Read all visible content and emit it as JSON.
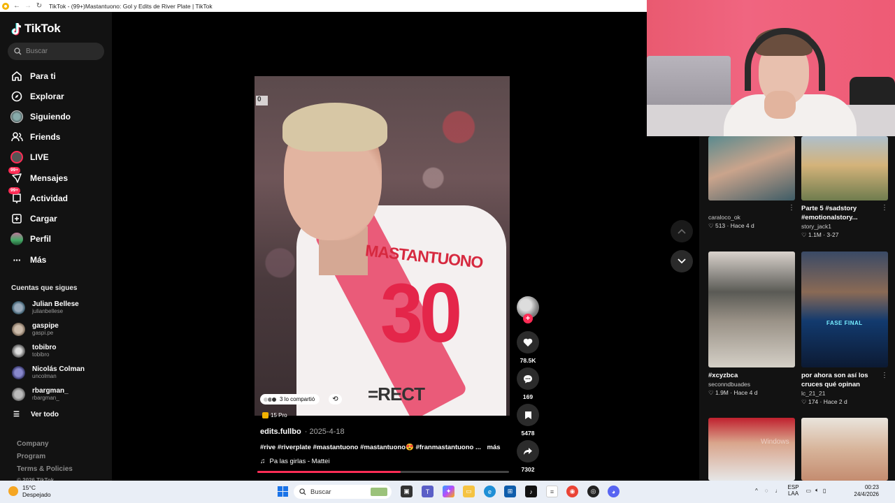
{
  "browser": {
    "tab_title": "TikTok - (99+)Mastantuono: Gol y Edits de River Plate | TikTok"
  },
  "sidebar": {
    "logo": "TikTok",
    "search_placeholder": "Buscar",
    "nav": [
      {
        "label": "Para ti",
        "icon": "home-icon"
      },
      {
        "label": "Explorar",
        "icon": "compass-icon"
      },
      {
        "label": "Siguiendo",
        "icon": "following-avatar-icon"
      },
      {
        "label": "Friends",
        "icon": "friends-icon"
      },
      {
        "label": "LIVE",
        "icon": "live-icon"
      },
      {
        "label": "Mensajes",
        "icon": "messages-icon",
        "badge": "99+"
      },
      {
        "label": "Actividad",
        "icon": "activity-icon",
        "badge": "99+"
      },
      {
        "label": "Cargar",
        "icon": "upload-icon"
      },
      {
        "label": "Perfil",
        "icon": "profile-avatar-icon"
      },
      {
        "label": "Más",
        "icon": "more-icon"
      }
    ],
    "following_title": "Cuentas que sigues",
    "following": [
      {
        "name": "Julian Bellese",
        "handle": "julianbellese"
      },
      {
        "name": "gaspipe",
        "handle": "gaspi.pe"
      },
      {
        "name": "tobibro",
        "handle": "tobibro"
      },
      {
        "name": "Nicolás Colman",
        "handle": "uncolman"
      },
      {
        "name": "rbargman_",
        "handle": "rbargman_"
      }
    ],
    "see_all": "Ver todo",
    "footer": [
      "Company",
      "Program",
      "Terms & Policies",
      "© 2026 TikTok"
    ]
  },
  "video": {
    "score_overlay": "0",
    "jersey_name": "MASTANTUONO",
    "jersey_number": "30",
    "jersey_sponsor": "=RECT",
    "shared_text": "3 lo compartió",
    "pro_tag": "15 Pro",
    "author": "edits.fullbo",
    "date": "· 2025-4-18",
    "description": "#rive #riverplate #mastantuono #mastantuono😍 #franmastantuono ...",
    "more_label": "más",
    "music": "Pa las girlas - Mattei",
    "progress": 0.57
  },
  "actions": {
    "likes": "78.5K",
    "comments": "169",
    "saves": "5478",
    "shares": "7302"
  },
  "right_panel": {
    "cards": [
      {
        "title": "",
        "user": "caraloco_ok",
        "meta": "♡ 513 · Hace 4 d"
      },
      {
        "title": "Parte 5 #sadstory #emotionalstory...",
        "user": "story_jack1",
        "meta": "♡ 1.1M · 3-27"
      },
      {
        "title": "#xcyzbca",
        "user": "seconndbuades",
        "meta": "♡ 1.9M · Hace 4 d"
      },
      {
        "title": "por ahora son así los cruces qué opinan",
        "user": "lc_21_21",
        "meta": "♡ 174 · Hace 2 d"
      }
    ],
    "thumb_caption": "FASE FINAL",
    "watermark": "Windows"
  },
  "taskbar": {
    "temperature": "15°C",
    "weather": "Despejado",
    "search": "Buscar",
    "lang_top": "ESP",
    "lang_bottom": "LAA",
    "time": "00:23",
    "date": "24/4/2026"
  },
  "colors": {
    "accent": "#fe2c55",
    "sidebar_bg": "#121212",
    "taskbar_bg": "#e9eef6"
  }
}
